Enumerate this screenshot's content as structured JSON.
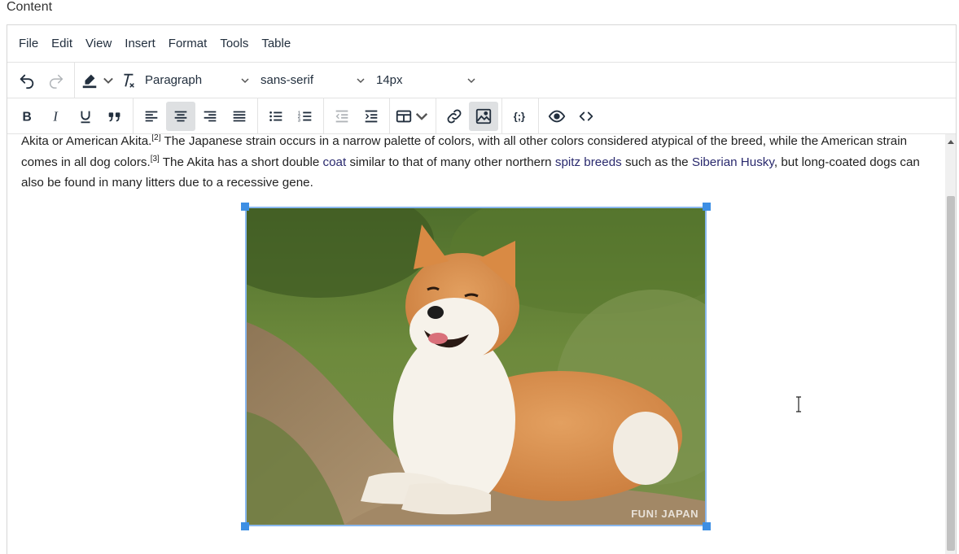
{
  "field": {
    "label": "Content"
  },
  "menubar": {
    "items": [
      "File",
      "Edit",
      "View",
      "Insert",
      "Format",
      "Tools",
      "Table"
    ]
  },
  "toolbar": {
    "block_format": "Paragraph",
    "font_family": "sans-serif",
    "font_size": "14px"
  },
  "content": {
    "seg1": "Akita or American Akita.",
    "sup1": "[2]",
    "seg2": " The Japanese strain occurs in a narrow palette of colors, with all other colors considered atypical of the breed, while the American strain comes in all dog colors.",
    "sup2": "[3]",
    "seg3": " The Akita has a short double ",
    "link1": "coat",
    "seg4": " similar to that of many other northern ",
    "link2": "spitz breeds",
    "seg5": " such as the ",
    "link3": "Siberian Husky",
    "seg6": ", but long-coated dogs can also be found in many litters due to a recessive gene.",
    "image_watermark": "FUN! JAPAN"
  },
  "colors": {
    "selection_border": "#8ab8ee",
    "handle": "#3d8fe4",
    "link": "#2a2a6e",
    "active_button": "#dee0e2"
  }
}
